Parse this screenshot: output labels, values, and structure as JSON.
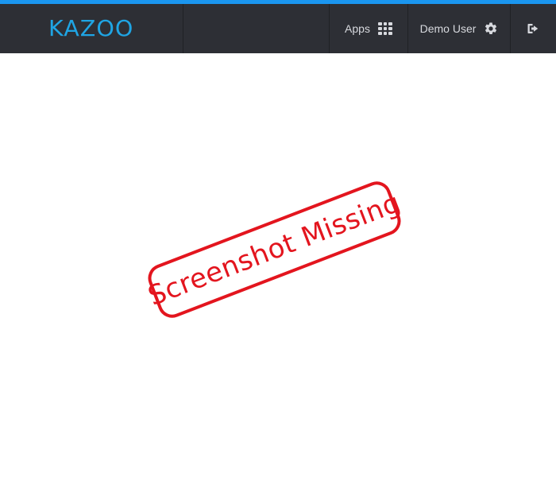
{
  "header": {
    "brand": "KAZOO",
    "apps_label": "Apps",
    "user_label": "Demo User"
  },
  "icons": {
    "apps": "grid-icon",
    "settings": "gear-icon",
    "logout": "logout-icon"
  },
  "content": {
    "stamp_text": "Screenshot Missing"
  },
  "colors": {
    "accent": "#1a96f0",
    "topbar": "#2d2f35",
    "brand": "#1fa5e4",
    "stamp": "#e3151e"
  }
}
